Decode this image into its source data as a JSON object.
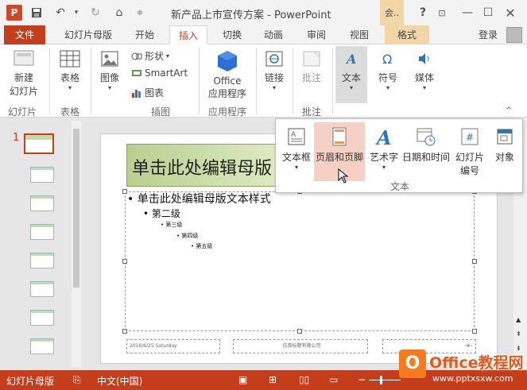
{
  "window": {
    "title": "新产品上市宣传方案 - PowerPoint",
    "context_tag": "会..",
    "login": "登录",
    "help": "?"
  },
  "tabs": [
    "文件",
    "幻灯片母版",
    "开始",
    "插入",
    "切换",
    "动画",
    "审阅",
    "视图",
    "格式"
  ],
  "active_tab": "插入",
  "ribbon": {
    "new_slide": "新建\n幻灯片",
    "new_slide_line1": "新建",
    "new_slide_line2": "幻灯片",
    "group_slides": "幻灯片",
    "table": "表格",
    "group_table": "表格",
    "image": "图像",
    "shapes": "形状",
    "smartart": "SmartArt",
    "chart": "图表",
    "group_illustrations": "插图",
    "office_apps_line1": "Office",
    "office_apps_line2": "应用程序",
    "group_apps": "应用程序",
    "links": "链接",
    "comment": "批注",
    "group_comment": "批注",
    "text": "文本",
    "symbols": "符号",
    "media": "媒体"
  },
  "dropdown": {
    "items": [
      {
        "icon": "text-box-icon",
        "label": "文本框",
        "label2": ""
      },
      {
        "icon": "header-footer-icon",
        "label": "页眉和页脚",
        "label2": ""
      },
      {
        "icon": "wordart-icon",
        "label": "艺术字",
        "label2": ""
      },
      {
        "icon": "date-time-icon",
        "label": "日期和时间",
        "label2": ""
      },
      {
        "icon": "slide-number-icon",
        "label": "幻灯片",
        "label2": "编号"
      },
      {
        "icon": "object-icon",
        "label": "对象",
        "label2": ""
      }
    ],
    "group_label": "文本"
  },
  "slide": {
    "title": "单击此处编辑母版",
    "body": {
      "level1": "单击此处编辑母版文本样式",
      "level2": "第二级",
      "level3": "第三级",
      "level4": "第四级",
      "level5": "第五级"
    },
    "footer_date": "2016/6/25 Saturday",
    "footer_text": "仿真标题有限公司",
    "footer_number": "‹#›"
  },
  "thumbnail_pane": {
    "slide_number": "1"
  },
  "statusbar": {
    "view": "幻灯片母版",
    "language": "中文(中国)"
  },
  "watermark": {
    "brand": "Office教程网",
    "url": "www.pptxsxw.com"
  },
  "colors": {
    "accent": "#c43e1c",
    "hover": "#f6d0c4",
    "context": "#f3d6a8"
  }
}
